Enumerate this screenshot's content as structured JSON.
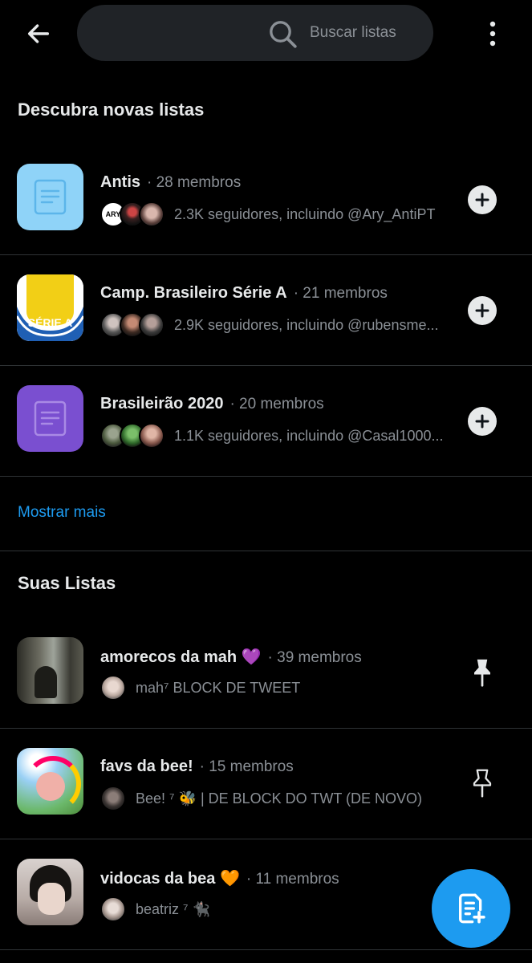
{
  "search": {
    "placeholder": "Buscar listas"
  },
  "discover": {
    "title": "Descubra novas listas",
    "lists": [
      {
        "name": "Antis",
        "members": "· 28 membros",
        "followers": "2.3K seguidores, incluindo @Ary_AntiPT"
      },
      {
        "name": "Camp. Brasileiro Série A",
        "members": "· 21 membros",
        "followers": "2.9K seguidores, incluindo @rubensme..."
      },
      {
        "name": "Brasileirão 2020",
        "members": "· 20 membros",
        "followers": "1.1K seguidores, incluindo @Casal1000..."
      }
    ],
    "show_more": "Mostrar mais",
    "badge_text": "SÉRIE A",
    "avatar_text": "ARY"
  },
  "your_lists": {
    "title": "Suas Listas",
    "lists": [
      {
        "name": "amorecos da mah 💜",
        "members": "· 39 membros",
        "owner": "mah⁷ BLOCK DE TWEET",
        "pinned": true
      },
      {
        "name": "favs da bee!",
        "members": "· 15 membros",
        "owner": "Bee! ⁷ 🐝 | DE BLOCK DO TWT (DE NOVO)",
        "pinned": false
      },
      {
        "name": "vidocas da bea 🧡",
        "members": "· 11 membros",
        "owner": "beatriz ⁷ 🐈‍⬛"
      }
    ]
  },
  "colors": {
    "accent": "#1d9bf0",
    "background": "#000000",
    "secondary_text": "#8b9096"
  },
  "icons": {
    "back": "arrow-left-icon",
    "search": "search-icon",
    "more": "kebab-vertical-icon",
    "add": "plus-icon",
    "pin": "pin-icon",
    "fab": "new-list-icon"
  }
}
